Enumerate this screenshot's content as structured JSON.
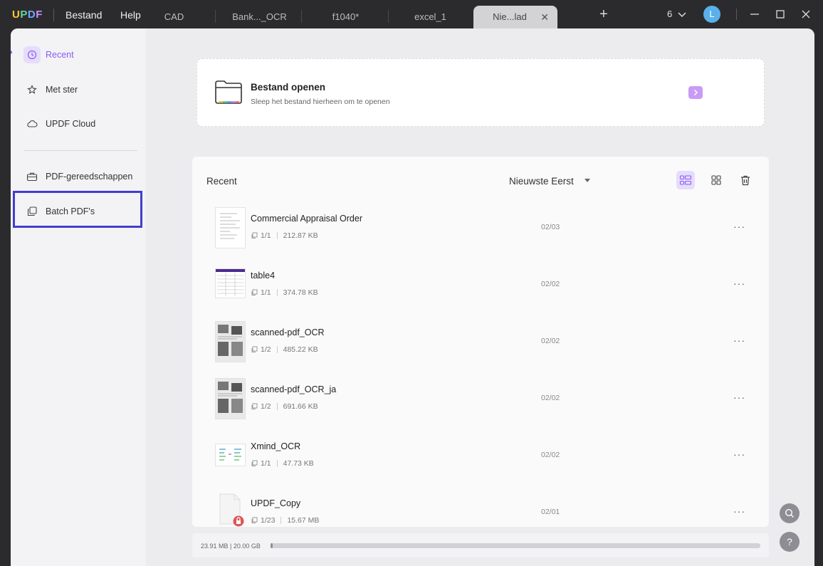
{
  "titlebar": {
    "logo": "UPDF",
    "menu": [
      "Bestand",
      "Help"
    ],
    "tabs": [
      {
        "label": "CAD",
        "active": false
      },
      {
        "label": "Bank..._OCR",
        "active": false
      },
      {
        "label": "f1040*",
        "active": false
      },
      {
        "label": "excel_1",
        "active": false
      },
      {
        "label": "Nie...lad",
        "active": true
      }
    ],
    "tab_close": "✕",
    "add_tab": "+",
    "tab_count": "6",
    "avatar_initial": "L"
  },
  "sidebar": {
    "items": [
      {
        "label": "Recent",
        "icon": "clock-icon",
        "active": true
      },
      {
        "label": "Met ster",
        "icon": "star-icon",
        "active": false
      },
      {
        "label": "UPDF Cloud",
        "icon": "cloud-icon",
        "active": false
      },
      {
        "label": "PDF-gereedschappen",
        "icon": "toolbox-icon",
        "active": false
      },
      {
        "label": "Batch PDF's",
        "icon": "batch-icon",
        "active": false
      }
    ]
  },
  "open_card": {
    "title": "Bestand openen",
    "subtitle": "Sleep het bestand hierheen om te openen"
  },
  "recent": {
    "title": "Recent",
    "sort_label": "Nieuwste Eerst",
    "files": [
      {
        "name": "Commercial Appraisal Order",
        "pages": "1/1",
        "size": "212.87 KB",
        "date": "02/03",
        "thumb": "document"
      },
      {
        "name": "table4",
        "pages": "1/1",
        "size": "374.78 KB",
        "date": "02/02",
        "thumb": "table"
      },
      {
        "name": "scanned-pdf_OCR",
        "pages": "1/2",
        "size": "485.22 KB",
        "date": "02/02",
        "thumb": "scan"
      },
      {
        "name": "scanned-pdf_OCR_ja",
        "pages": "1/2",
        "size": "691.66 KB",
        "date": "02/02",
        "thumb": "scan"
      },
      {
        "name": "Xmind_OCR",
        "pages": "1/1",
        "size": "47.73 KB",
        "date": "02/02",
        "thumb": "mindmap"
      },
      {
        "name": "UPDF_Copy",
        "pages": "1/23",
        "size": "15.67 MB",
        "date": "02/01",
        "thumb": "locked"
      }
    ],
    "more_label": "···"
  },
  "storage": {
    "text": "23.91 MB | 20.00 GB",
    "used_fraction": 0.0012
  },
  "fab": {
    "help_label": "?"
  },
  "colors": {
    "accent": "#8a5cf6",
    "highlight_border": "#3f3fd0",
    "titlebar_bg": "#2b2b2e"
  }
}
